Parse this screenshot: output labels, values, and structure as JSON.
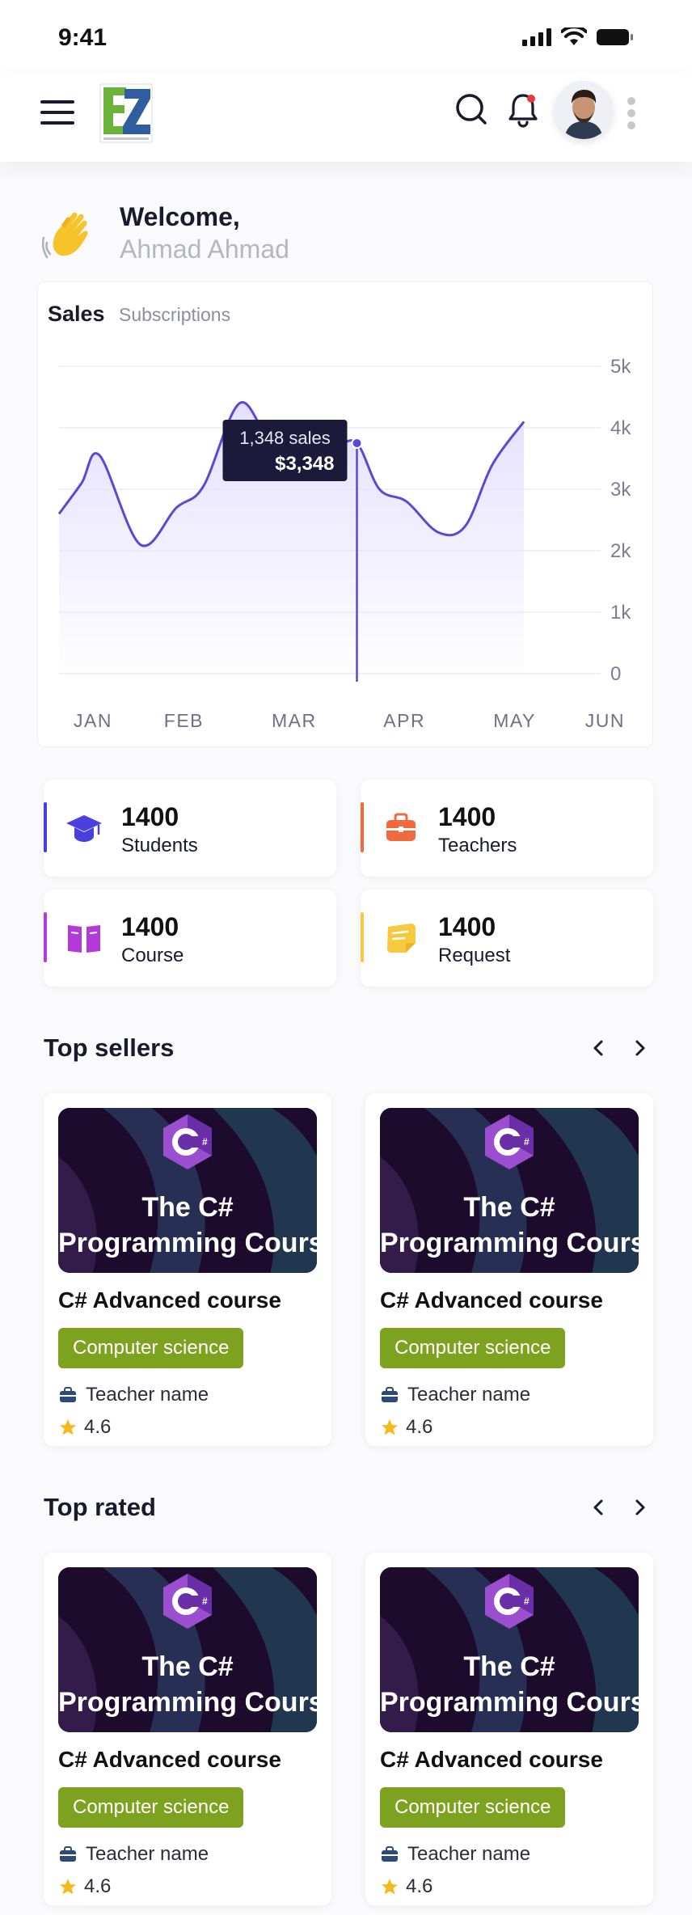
{
  "status_bar": {
    "time": "9:41"
  },
  "header": {
    "logo_alt": "EZ"
  },
  "welcome": {
    "title": "Welcome,",
    "name": "Ahmad Ahmad"
  },
  "sales": {
    "active_tab": "Sales",
    "other_tab": "Subscriptions",
    "tooltip": {
      "line1": "1,348 sales",
      "line2": "$3,348"
    }
  },
  "chart_data": {
    "type": "area",
    "categories": [
      "JAN",
      "FEB",
      "MAR",
      "APR",
      "MAY",
      "JUN"
    ],
    "y_ticks": [
      "5k",
      "4k",
      "3k",
      "2k",
      "1k",
      "0"
    ],
    "ylim": [
      0,
      5000
    ],
    "grid": true,
    "series": [
      {
        "x": [
          0,
          0.25,
          0.45,
          0.9,
          1.3,
          1.6,
          2.0,
          2.35,
          2.7,
          3.05,
          3.3,
          3.55,
          3.85,
          4.2,
          4.5,
          4.8,
          5.15
        ],
        "values": [
          2600,
          3100,
          3550,
          2100,
          2700,
          3050,
          4400,
          3800,
          4100,
          3750,
          3750,
          3000,
          2800,
          2300,
          2400,
          3400,
          4100
        ]
      }
    ],
    "highlight": {
      "x": 3.3,
      "value": 3750
    },
    "line_color": "#5b49d6",
    "fill_color": "#e5e0ff"
  },
  "stats": [
    {
      "value": "1400",
      "label": "Students",
      "color": "#4b3fe0",
      "icon": "graduation-cap-icon"
    },
    {
      "value": "1400",
      "label": "Teachers",
      "color": "#ee6a3f",
      "icon": "briefcase-icon"
    },
    {
      "value": "1400",
      "label": "Course",
      "color": "#b23bd8",
      "icon": "book-icon"
    },
    {
      "value": "1400",
      "label": "Request",
      "color": "#f6c93f",
      "icon": "note-icon"
    }
  ],
  "top_sellers": {
    "title": "Top sellers",
    "courses": [
      {
        "thumb_line1": "The C#",
        "thumb_line2": "Programming Course",
        "title": "C# Advanced course",
        "tag": "Computer science",
        "teacher": "Teacher name",
        "rating": "4.6"
      },
      {
        "thumb_line1": "The C#",
        "thumb_line2": "Programming Course",
        "title": "C# Advanced course",
        "tag": "Computer science",
        "teacher": "Teacher name",
        "rating": "4.6"
      }
    ]
  },
  "top_rated": {
    "title": "Top rated",
    "courses": [
      {
        "thumb_line1": "The C#",
        "thumb_line2": "Programming Course",
        "title": "C# Advanced course",
        "tag": "Computer science",
        "teacher": "Teacher name",
        "rating": "4.6"
      },
      {
        "thumb_line1": "The C#",
        "thumb_line2": "Programming Course",
        "title": "C# Advanced course",
        "tag": "Computer science",
        "teacher": "Teacher name",
        "rating": "4.6"
      }
    ]
  },
  "colors": {
    "accent": "#5b49d6",
    "tag_green": "#7da21f",
    "dark": "#1a1a2e"
  }
}
